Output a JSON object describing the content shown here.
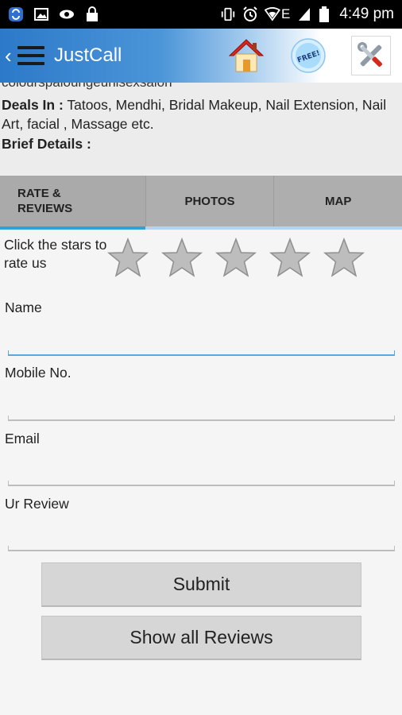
{
  "status_bar": {
    "left_icons": [
      "sync-icon",
      "image-icon",
      "eye-icon",
      "lock-icon"
    ],
    "right_icons": [
      "vibrate-icon",
      "alarm-icon",
      "wifi-icon",
      "signal-icon",
      "battery-icon"
    ],
    "network": "E",
    "time": "4:49 pm"
  },
  "app_bar": {
    "title": "JustCall",
    "icons": [
      "back-chevron-icon",
      "menu-icon",
      "home-icon",
      "free-badge-icon",
      "tools-icon"
    ],
    "free_badge_text": "FREE!"
  },
  "details": {
    "clipped_name": "colourspaloungeunisexsalon",
    "deals_label": "Deals In :",
    "deals_value": " Tatoos, Mendhi, Bridal Makeup, Nail Extension, Nail Art, facial , Massage etc.",
    "brief_label": "Brief Details :"
  },
  "tabs": [
    {
      "label": "RATE &\nREVIEWS",
      "active": true
    },
    {
      "label": "PHOTOS",
      "active": false
    },
    {
      "label": "MAP",
      "active": false
    }
  ],
  "rating": {
    "prompt": "Click the stars to rate us",
    "max_stars": 5,
    "selected": 0
  },
  "form": {
    "name_label": "Name",
    "name_value": "",
    "mobile_label": "Mobile No.",
    "mobile_value": "",
    "email_label": "Email",
    "email_value": "",
    "review_label": "Ur Review",
    "review_value": ""
  },
  "buttons": {
    "submit": "Submit",
    "show_all": "Show all Reviews"
  },
  "colors": {
    "app_bar_blue": "#2c79c9",
    "tab_bar": "#aeaeae",
    "tab_indicator": "#33a1d6",
    "focused_underline": "#5aa9de",
    "button_bg": "#d6d6d6"
  }
}
